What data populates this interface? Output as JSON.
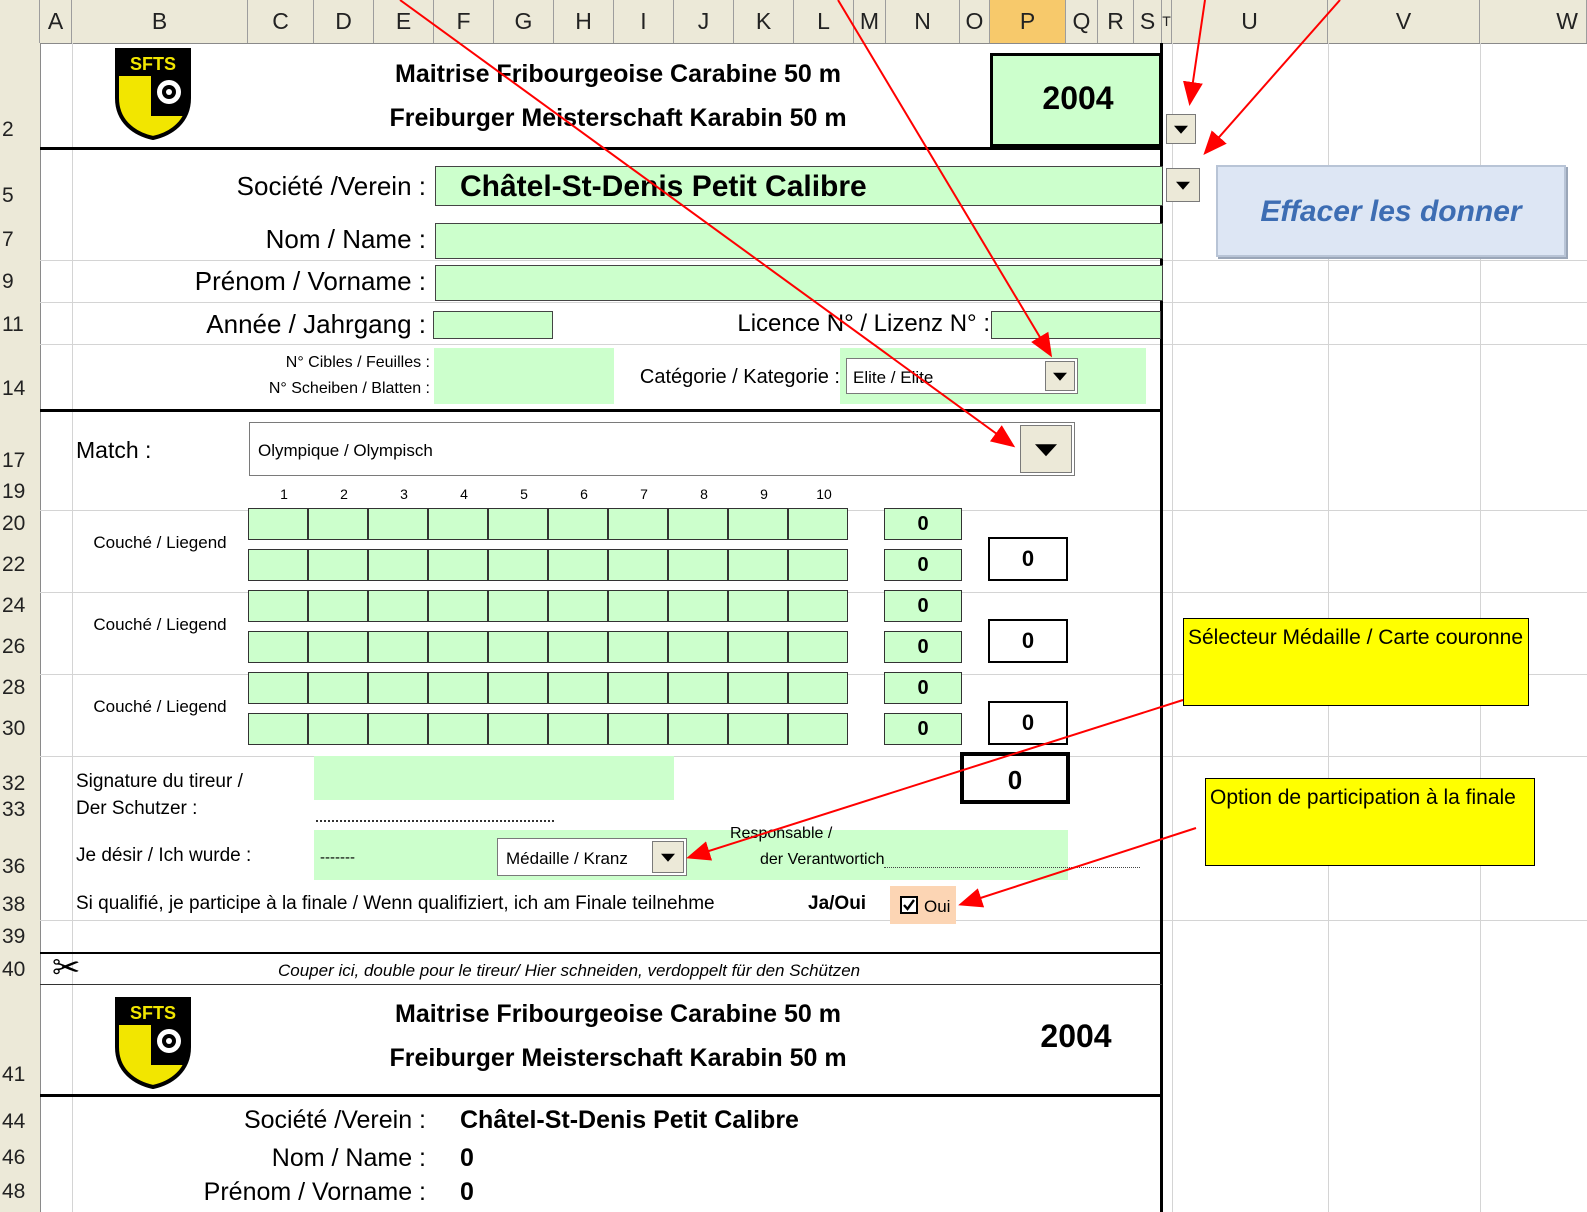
{
  "columns": [
    "A",
    "B",
    "C",
    "D",
    "E",
    "F",
    "G",
    "H",
    "I",
    "J",
    "K",
    "L",
    "M",
    "N",
    "O",
    "P",
    "Q",
    "R",
    "S",
    "T",
    "U",
    "V",
    "W"
  ],
  "rows": [
    "2",
    "5",
    "7",
    "9",
    "11",
    "14",
    "17",
    "19",
    "20",
    "22",
    "24",
    "26",
    "28",
    "30",
    "32",
    "33",
    "36",
    "38",
    "39",
    "40",
    "41",
    "44",
    "46",
    "48"
  ],
  "header": {
    "title_fr": "Maitrise Fribourgeoise Carabine 50 m",
    "title_de": "Freiburger Meisterschaft Karabin 50 m",
    "year": "2004",
    "logo_text": "SFTS"
  },
  "form": {
    "societe_label": "Société /Verein :",
    "societe_value": "Châtel-St-Denis Petit Calibre",
    "nom_label": "Nom / Name :",
    "prenom_label": "Prénom / Vorname :",
    "annee_label": "Année / Jahrgang :",
    "licence_label": "Licence N° / Lizenz N° :",
    "cibles_label_1": "N° Cibles / Feuilles :",
    "cibles_label_2": "N° Scheiben / Blatten :",
    "categorie_label": "Catégorie / Kategorie :",
    "categorie_value": "Elite / Elite",
    "match_label": "Match :",
    "match_value": "Olympique / Olympisch",
    "clear_button": "Effacer les donner"
  },
  "scores": {
    "shot_numbers": [
      "1",
      "2",
      "3",
      "4",
      "5",
      "6",
      "7",
      "8",
      "9",
      "10"
    ],
    "series": [
      {
        "label": "Couché / Liegend",
        "row_totals": [
          "0",
          "0"
        ],
        "total": "0"
      },
      {
        "label": "Couché / Liegend",
        "row_totals": [
          "0",
          "0"
        ],
        "total": "0"
      },
      {
        "label": "Couché / Liegend",
        "row_totals": [
          "0",
          "0"
        ],
        "total": "0"
      }
    ],
    "grand_total": "0"
  },
  "signature": {
    "label_1": "Signature du tireur /",
    "label_2": "Der Schutzer :"
  },
  "wish": {
    "label": "Je désir / Ich wurde :",
    "dashes": "-------",
    "select_value": "Médaille / Kranz",
    "responsable_1": "Responsable /",
    "responsable_2": "der Verantwortich"
  },
  "finale": {
    "text": "Si qualifié, je participe à la finale / Wenn qualifiziert, ich am Finale teilnehme",
    "ja_oui": "Ja/Oui",
    "checkbox_label": "Oui",
    "checked": true
  },
  "cut_line": {
    "scissors": "✂",
    "text": "Couper ici, double pour le tireur/ Hier schneiden, verdoppelt für den Schützen"
  },
  "copy": {
    "title_fr": "Maitrise Fribourgeoise Carabine 50 m",
    "title_de": "Freiburger Meisterschaft Karabin 50 m",
    "year": "2004",
    "societe_label": "Société /Verein :",
    "societe_value": "Châtel-St-Denis Petit Calibre",
    "nom_label": "Nom / Name :",
    "nom_value": "0",
    "prenom_label": "Prénom / Vorname :",
    "prenom_value": "0"
  },
  "callouts": {
    "medal": "Sélecteur Médaille / Carte couronne",
    "finale": "Option de participation à la finale"
  },
  "colors": {
    "field_green": "#ccffcc",
    "callout_yellow": "#ffff00",
    "arrow_red": "#ff0000",
    "button_text": "#3d6db3"
  }
}
